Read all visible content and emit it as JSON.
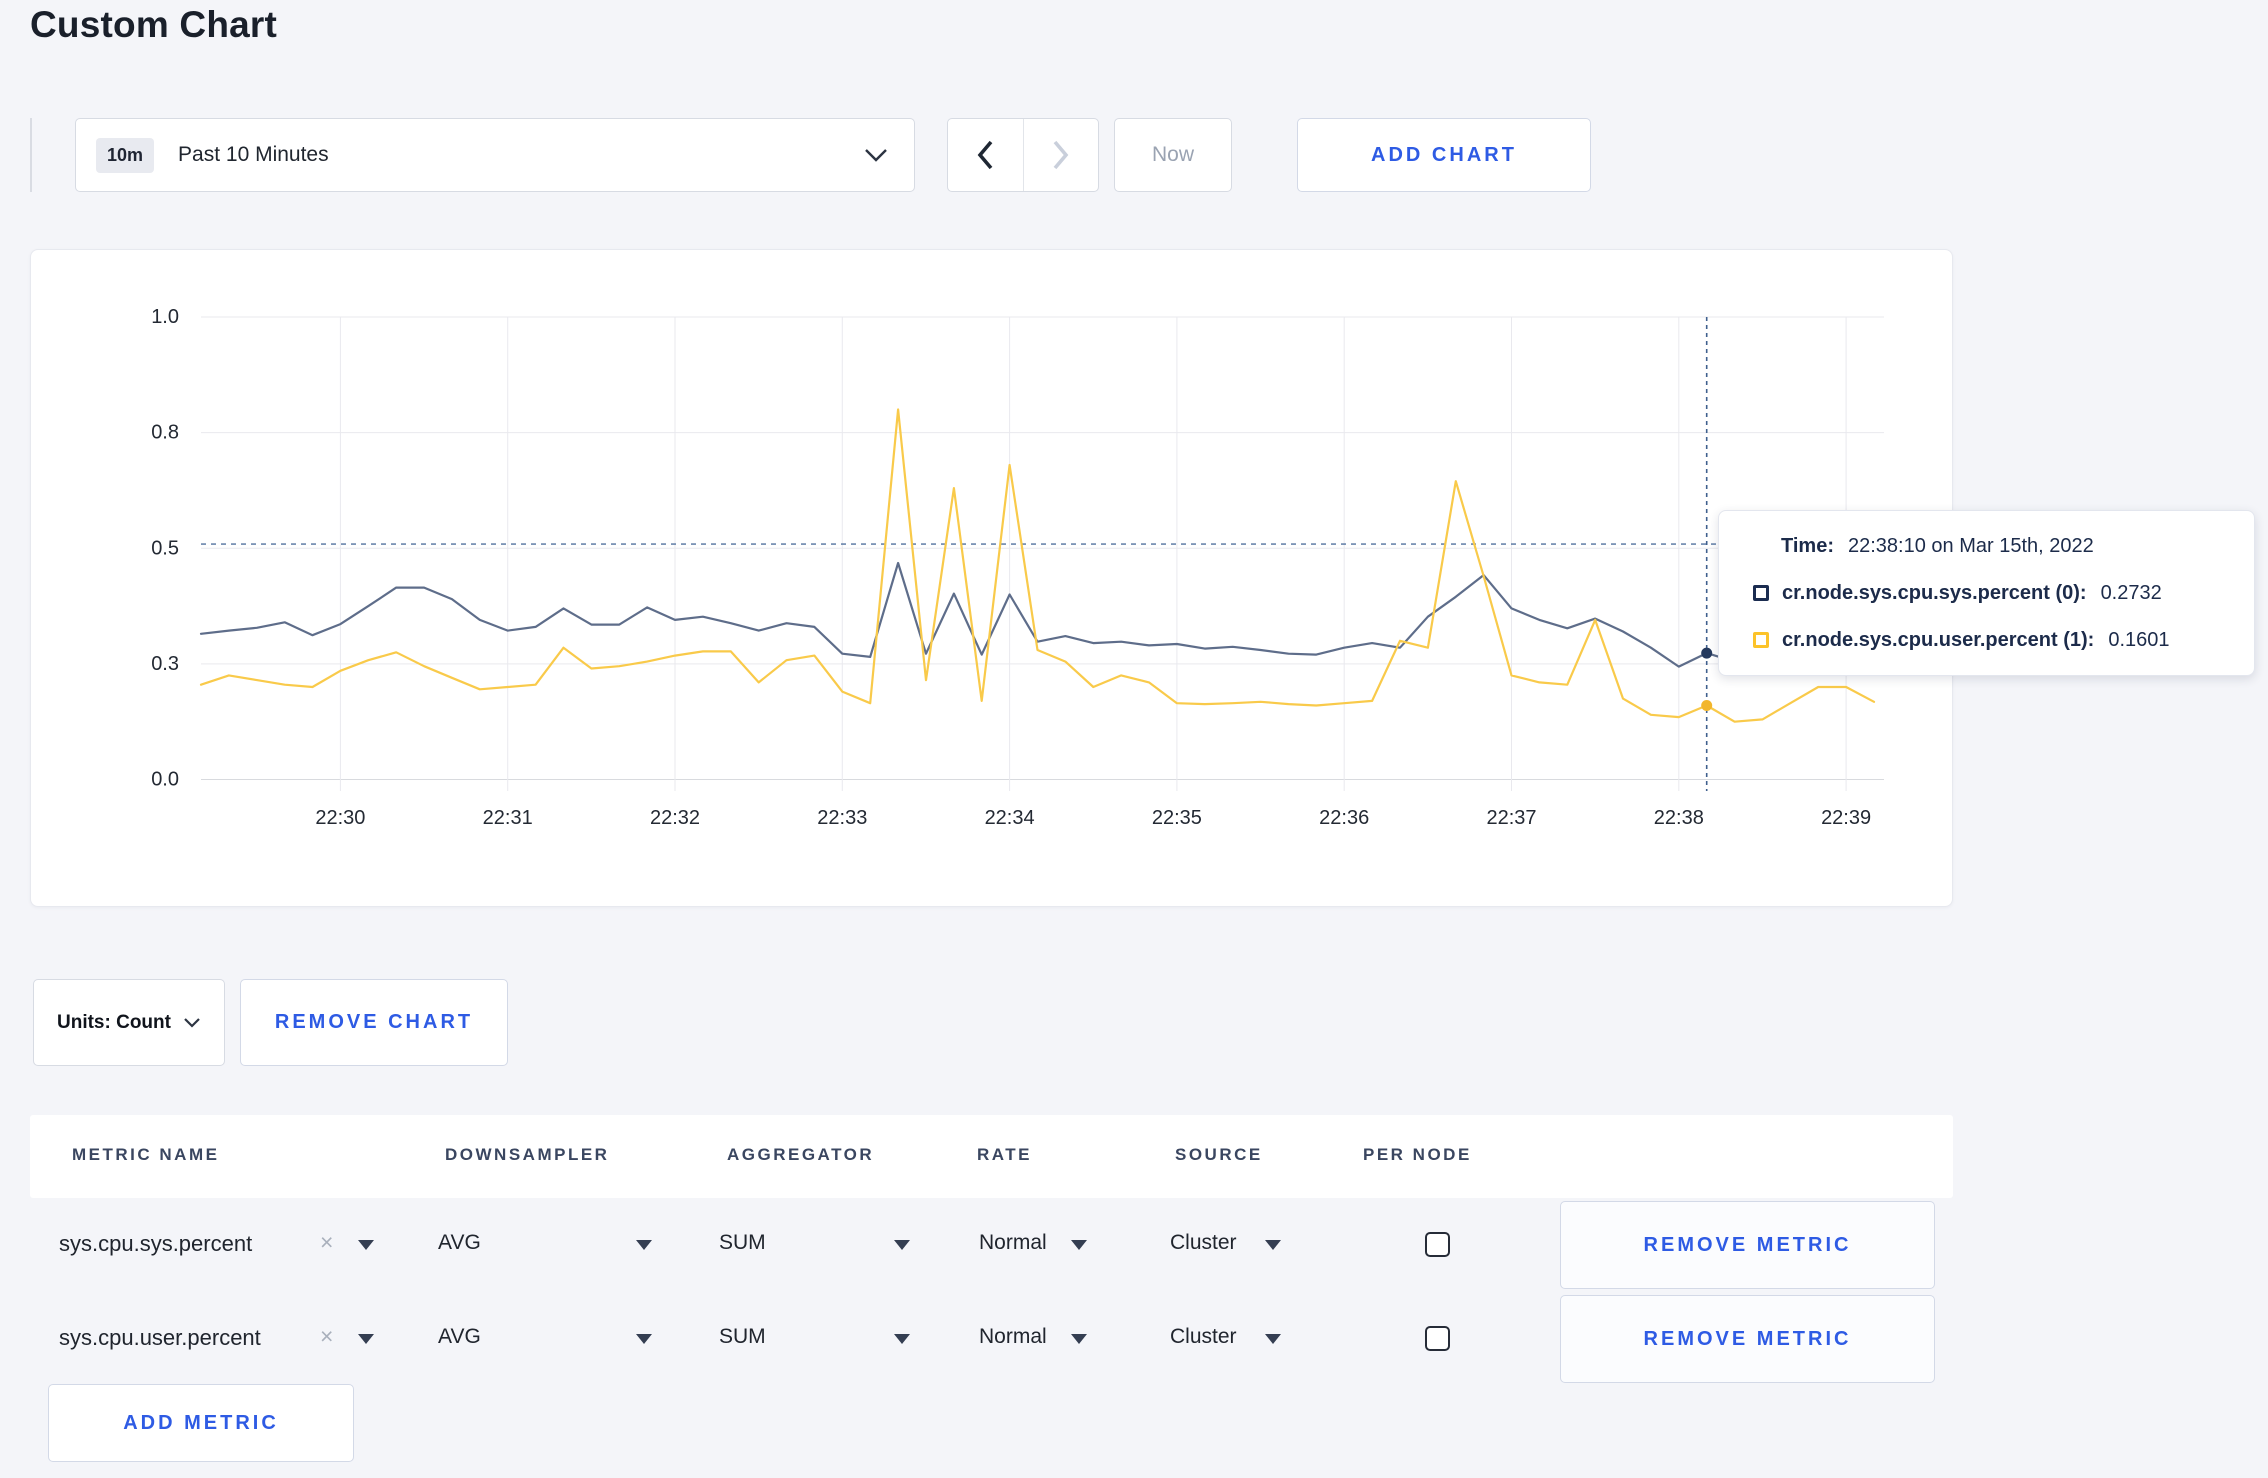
{
  "page": {
    "title": "Custom Chart",
    "background": "#f4f5f9",
    "accent_blue": "#2e5be4"
  },
  "icons": {
    "close": "×",
    "chevron_down": "⌄",
    "chevron_left": "‹",
    "chevron_right": "›"
  },
  "toolbar": {
    "time_range": {
      "badge": "10m",
      "label": "Past 10 Minutes"
    },
    "now_label": "Now",
    "add_chart_label": "ADD CHART"
  },
  "tooltip": {
    "time_label": "Time:",
    "time_value": "22:38:10 on Mar 15th, 2022",
    "series": [
      {
        "label": "cr.node.sys.cpu.sys.percent (0):",
        "value": "0.2732",
        "swatch_color": "#1b2c50"
      },
      {
        "label": "cr.node.sys.cpu.user.percent (1):",
        "value": "0.1601",
        "swatch_color": "#fcc32a"
      }
    ]
  },
  "chart_controls": {
    "units_label": "Units: Count",
    "remove_chart_label": "REMOVE CHART"
  },
  "metrics_table": {
    "headers": [
      "METRIC NAME",
      "DOWNSAMPLER",
      "AGGREGATOR",
      "RATE",
      "SOURCE",
      "PER NODE"
    ],
    "rows": [
      {
        "metric": "sys.cpu.sys.percent",
        "downsampler": "AVG",
        "aggregator": "SUM",
        "rate": "Normal",
        "source": "Cluster",
        "per_node_checked": false,
        "remove_label": "REMOVE METRIC"
      },
      {
        "metric": "sys.cpu.user.percent",
        "downsampler": "AVG",
        "aggregator": "SUM",
        "rate": "Normal",
        "source": "Cluster",
        "per_node_checked": false,
        "remove_label": "REMOVE METRIC"
      }
    ],
    "add_metric_label": "ADD METRIC"
  },
  "chart_data": {
    "type": "line",
    "ylabel": "",
    "xlabel": "",
    "ylim": [
      0,
      1
    ],
    "grid": true,
    "legend_position": "tooltip",
    "y_ticks": [
      {
        "v": 0,
        "label": "0.0"
      },
      {
        "v": 0.25,
        "label": "0.3"
      },
      {
        "v": 0.5,
        "label": "0.5"
      },
      {
        "v": 0.75,
        "label": "0.8"
      },
      {
        "v": 1.0,
        "label": "1.0"
      }
    ],
    "x_domain_seconds": [
      0,
      600
    ],
    "sample_interval_seconds": 10,
    "first_sample_offset_seconds": 0,
    "x_ticks": [
      {
        "s": 50,
        "label": "22:30"
      },
      {
        "s": 110,
        "label": "22:31"
      },
      {
        "s": 170,
        "label": "22:32"
      },
      {
        "s": 230,
        "label": "22:33"
      },
      {
        "s": 290,
        "label": "22:34"
      },
      {
        "s": 350,
        "label": "22:35"
      },
      {
        "s": 410,
        "label": "22:36"
      },
      {
        "s": 470,
        "label": "22:37"
      },
      {
        "s": 530,
        "label": "22:38"
      },
      {
        "s": 590,
        "label": "22:39"
      }
    ],
    "guide_value": 0.509,
    "crosshair_offset_s": 540,
    "crosshair_time": "22:38:10",
    "series": [
      {
        "name": "cr.node.sys.cpu.sys.percent (0)",
        "metric": "sys.cpu.sys.percent",
        "line_color": "#5e6d8a",
        "swatch_color": "#253a5e",
        "hover_value": 0.2732,
        "values": [
          0.315,
          0.322,
          0.328,
          0.34,
          0.312,
          0.336,
          0.375,
          0.415,
          0.415,
          0.39,
          0.345,
          0.322,
          0.33,
          0.37,
          0.335,
          0.335,
          0.372,
          0.345,
          0.352,
          0.338,
          0.322,
          0.338,
          0.33,
          0.272,
          0.265,
          0.468,
          0.272,
          0.402,
          0.27,
          0.4,
          0.298,
          0.31,
          0.295,
          0.298,
          0.29,
          0.293,
          0.283,
          0.287,
          0.28,
          0.272,
          0.27,
          0.285,
          0.295,
          0.285,
          0.352,
          0.395,
          0.442,
          0.37,
          0.345,
          0.327,
          0.348,
          0.32,
          0.285,
          0.244,
          0.2732,
          0.255,
          0.285,
          0.29,
          0.3,
          0.295,
          0.3
        ]
      },
      {
        "name": "cr.node.sys.cpu.user.percent (1)",
        "metric": "sys.cpu.user.percent",
        "line_color": "#f9ca4a",
        "swatch_color": "#f2b62c",
        "hover_value": 0.1601,
        "values": [
          0.205,
          0.225,
          0.215,
          0.205,
          0.2,
          0.235,
          0.258,
          0.275,
          0.245,
          0.22,
          0.195,
          0.2,
          0.205,
          0.285,
          0.24,
          0.245,
          0.255,
          0.268,
          0.277,
          0.277,
          0.21,
          0.258,
          0.268,
          0.19,
          0.165,
          0.8,
          0.215,
          0.63,
          0.17,
          0.68,
          0.28,
          0.255,
          0.2,
          0.225,
          0.21,
          0.165,
          0.163,
          0.165,
          0.168,
          0.163,
          0.16,
          0.165,
          0.17,
          0.3,
          0.285,
          0.645,
          0.44,
          0.225,
          0.21,
          0.205,
          0.345,
          0.175,
          0.14,
          0.135,
          0.1601,
          0.125,
          0.13,
          0.165,
          0.2,
          0.2,
          0.168
        ]
      }
    ]
  }
}
